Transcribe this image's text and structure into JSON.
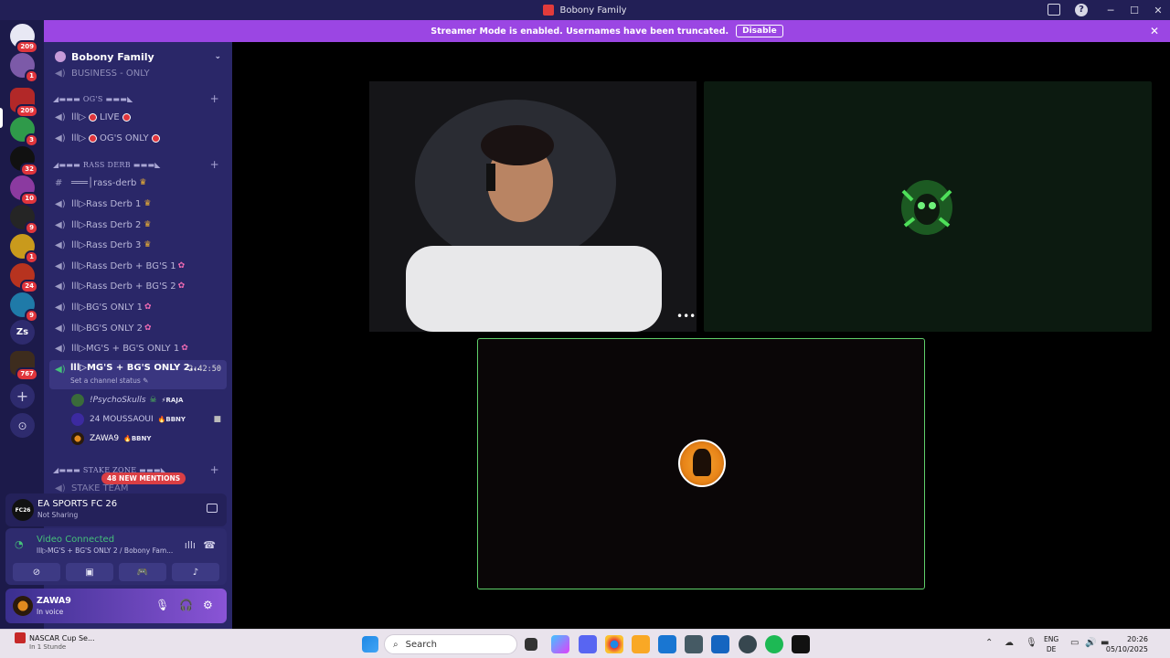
{
  "window": {
    "title": "Bobony Family"
  },
  "banner": {
    "text": "Streamer Mode is enabled. Usernames have been truncated.",
    "button": "Disable"
  },
  "guilds": [
    {
      "badge": "209"
    },
    {
      "badge": "1"
    },
    {
      "badge": "209"
    },
    {
      "badge": "3"
    },
    {
      "badge": "32"
    },
    {
      "badge": "10"
    },
    {
      "badge": "9"
    },
    {
      "badge": "1"
    },
    {
      "badge": "24"
    },
    {
      "badge": "9"
    },
    {
      "label": "Zs"
    },
    {
      "badge": "767"
    }
  ],
  "server": {
    "name": "Bobony Family"
  },
  "channels": {
    "business": "BUSINESS - ONLY",
    "cat_ogs": "◢▬▬▬ OG'S ▬▬▬◣",
    "live": "LIVE",
    "ogs_only": "OG'S ONLY",
    "cat_rass": "◢▬▬▬ RASS DERB ▬▬▬◣",
    "rass_derb_text": "rass-derb",
    "rd1": "Rass Derb 1",
    "rd2": "Rass Derb 2",
    "rd3": "Rass Derb 3",
    "rdbg1": "Rass Derb + BG'S 1",
    "rdbg2": "Rass Derb + BG'S 2",
    "bg1": "BG'S ONLY 1",
    "bg2": "BG'S ONLY 2",
    "mgbg1": "MG'S + BG'S ONLY 1",
    "active": "MG'S + BG'S ONLY 2...",
    "active_timer": "2:42:50",
    "active_status": "Set a channel status",
    "cat_stake": "◢▬▬▬ STAKE ZONE ▬▬▬◣",
    "stake_team": "STAKE TEAM"
  },
  "voice_users": [
    {
      "name": "!PsychoSkulls",
      "tag": "RAJA"
    },
    {
      "name": "24 MOUSSAOUI",
      "tag": "BBNY"
    },
    {
      "name": "ZAWA9",
      "tag": "BBNY"
    }
  ],
  "mentions": "48 NEW MENTIONS",
  "game_panel": {
    "title": "EA SPORTS FC 26",
    "status": "Not Sharing",
    "logo": "FC26"
  },
  "voice_panel": {
    "title": "Video Connected",
    "subtitle": "lll▷MG'S + BG'S ONLY 2 / Bobony Fam..."
  },
  "user_panel": {
    "name": "ZAWA9",
    "status": "In voice"
  },
  "taskbar": {
    "news_title": "NASCAR Cup Se...",
    "news_sub": "In 1 Stunde",
    "search_placeholder": "Search",
    "lang1": "ENG",
    "lang2": "DE",
    "time": "20:26",
    "date": "05/10/2025"
  },
  "colors": {
    "accent": "#9b46e3",
    "green": "#45c07a",
    "sidebar": "#2a2768",
    "guildbar": "#1c1a4a"
  }
}
